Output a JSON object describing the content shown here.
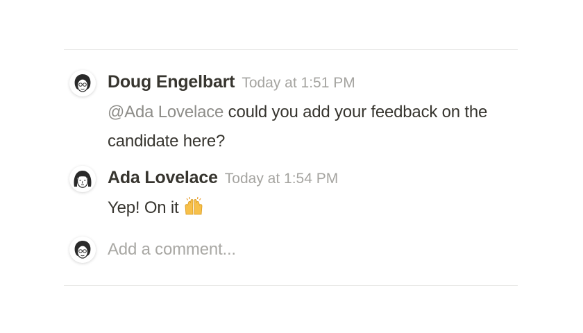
{
  "comments": [
    {
      "author": "Doug Engelbart",
      "timestamp": "Today at 1:51 PM",
      "mention": "@Ada Lovelace",
      "text": " could you add your feedback on the candidate here?",
      "avatar_icon": "avatar-doug-engelbart-icon"
    },
    {
      "author": "Ada Lovelace",
      "timestamp": "Today at 1:54 PM",
      "text": "Yep! On it",
      "emoji": "raising-hands-icon",
      "avatar_icon": "avatar-ada-lovelace-icon"
    }
  ],
  "composer": {
    "placeholder": "Add a comment...",
    "avatar_icon": "avatar-current-user-icon"
  },
  "colors": {
    "text": "#37352f",
    "secondary_text": "#a5a4a0",
    "mention": "#8e8d89",
    "divider": "#e9e9e7"
  }
}
